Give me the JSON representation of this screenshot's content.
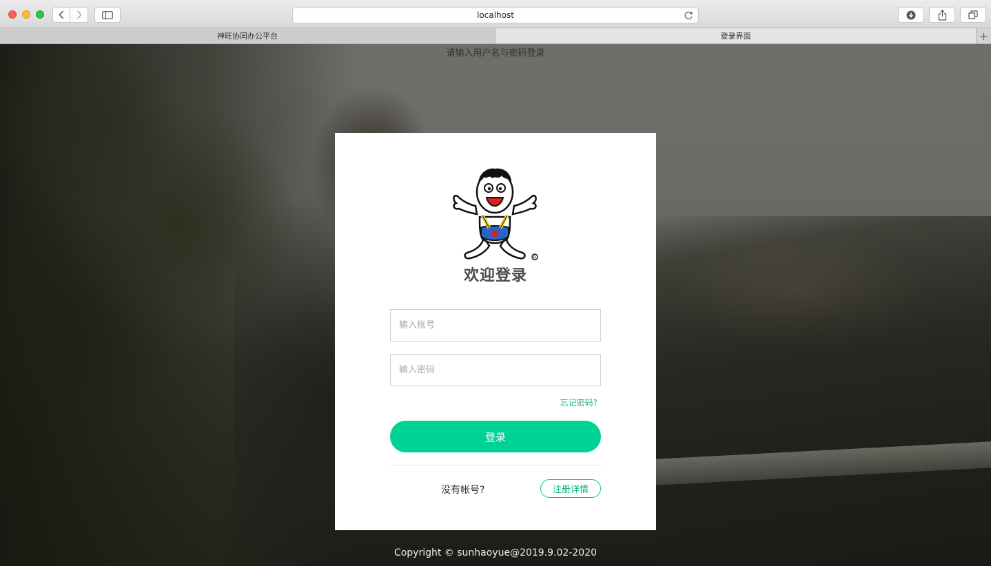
{
  "browser": {
    "address": "localhost",
    "tabs": [
      {
        "label": "神旺协同办公平台",
        "active": false
      },
      {
        "label": "登录界面",
        "active": true
      }
    ],
    "new_tab_symbol": "+"
  },
  "page": {
    "hint": "请输入用户名与密码登录",
    "welcome": "欢迎登录",
    "account_placeholder": "输入帐号",
    "password_placeholder": "输入密码",
    "forgot_password": "忘记密码?",
    "login_button": "登录",
    "no_account": "没有帐号?",
    "register_button": "注册详情",
    "footer": "Copyright © sunhaoyue@2019.9.02-2020"
  },
  "colors": {
    "accent": "#00d195",
    "link": "#1fb386",
    "card_bg": "#ffffff"
  },
  "icons": [
    "back-icon",
    "forward-icon",
    "sidebar-icon",
    "reload-icon",
    "download-icon",
    "share-icon",
    "tabs-overview-icon",
    "mascot-logo"
  ]
}
